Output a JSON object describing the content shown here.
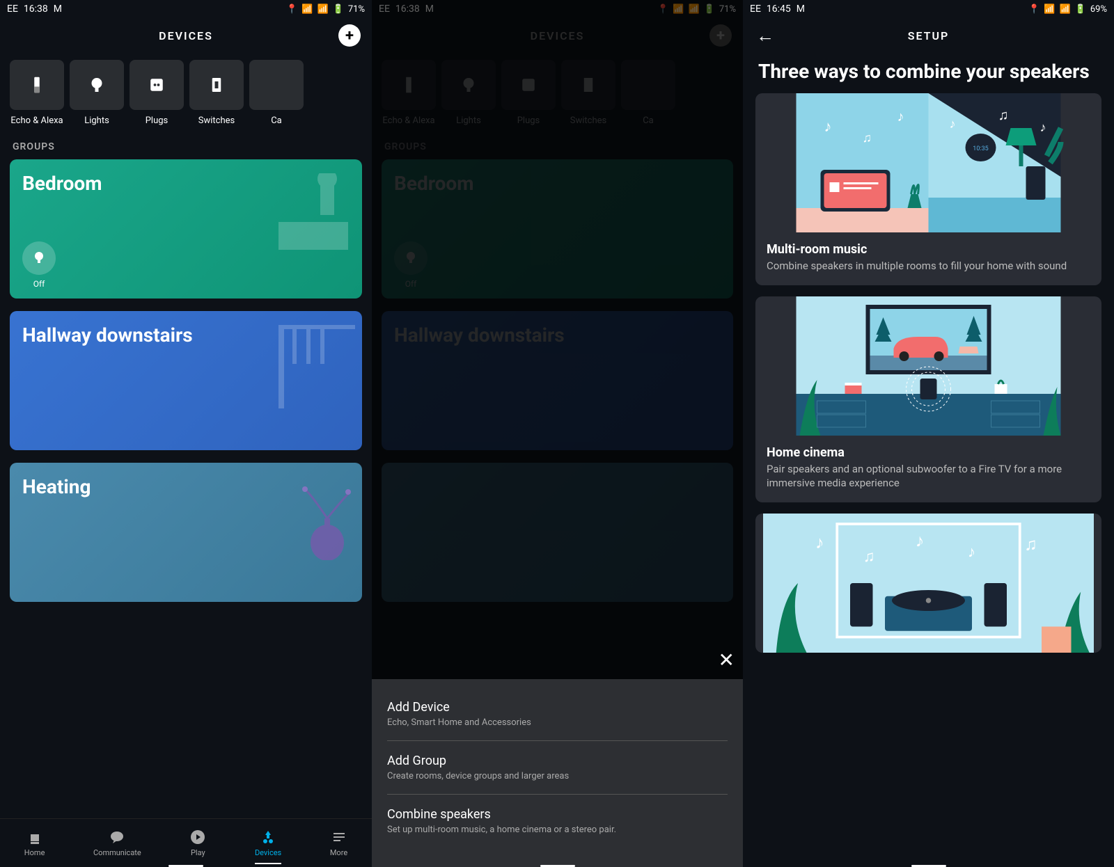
{
  "status": {
    "carrier": "EE",
    "time1": "16:38",
    "time2": "16:38",
    "time3": "16:45",
    "battery1": "71%",
    "battery2": "71%",
    "battery3": "69%"
  },
  "screen1": {
    "header": "DEVICES",
    "categories": [
      {
        "label": "Echo & Alexa"
      },
      {
        "label": "Lights"
      },
      {
        "label": "Plugs"
      },
      {
        "label": "Switches"
      },
      {
        "label": "Ca"
      }
    ],
    "groups_label": "GROUPS",
    "groups": [
      {
        "name": "Bedroom",
        "bulb_state": "Off"
      },
      {
        "name": "Hallway downstairs"
      },
      {
        "name": "Heating"
      }
    ],
    "nav": [
      {
        "label": "Home"
      },
      {
        "label": "Communicate"
      },
      {
        "label": "Play"
      },
      {
        "label": "Devices"
      },
      {
        "label": "More"
      }
    ]
  },
  "screen2": {
    "header": "DEVICES",
    "groups_label": "GROUPS",
    "sheet": [
      {
        "title": "Add Device",
        "desc": "Echo, Smart Home and Accessories"
      },
      {
        "title": "Add Group",
        "desc": "Create rooms, device groups and larger areas"
      },
      {
        "title": "Combine speakers",
        "desc": "Set up multi-room music, a home cinema or a stereo pair."
      }
    ]
  },
  "screen3": {
    "header": "SETUP",
    "title": "Three ways to combine your speakers",
    "cards": [
      {
        "title": "Multi-room music",
        "desc": "Combine speakers in multiple rooms to fill your home with sound"
      },
      {
        "title": "Home cinema",
        "desc": "Pair speakers and an optional subwoofer to a Fire TV for a more immersive media experience"
      }
    ]
  }
}
